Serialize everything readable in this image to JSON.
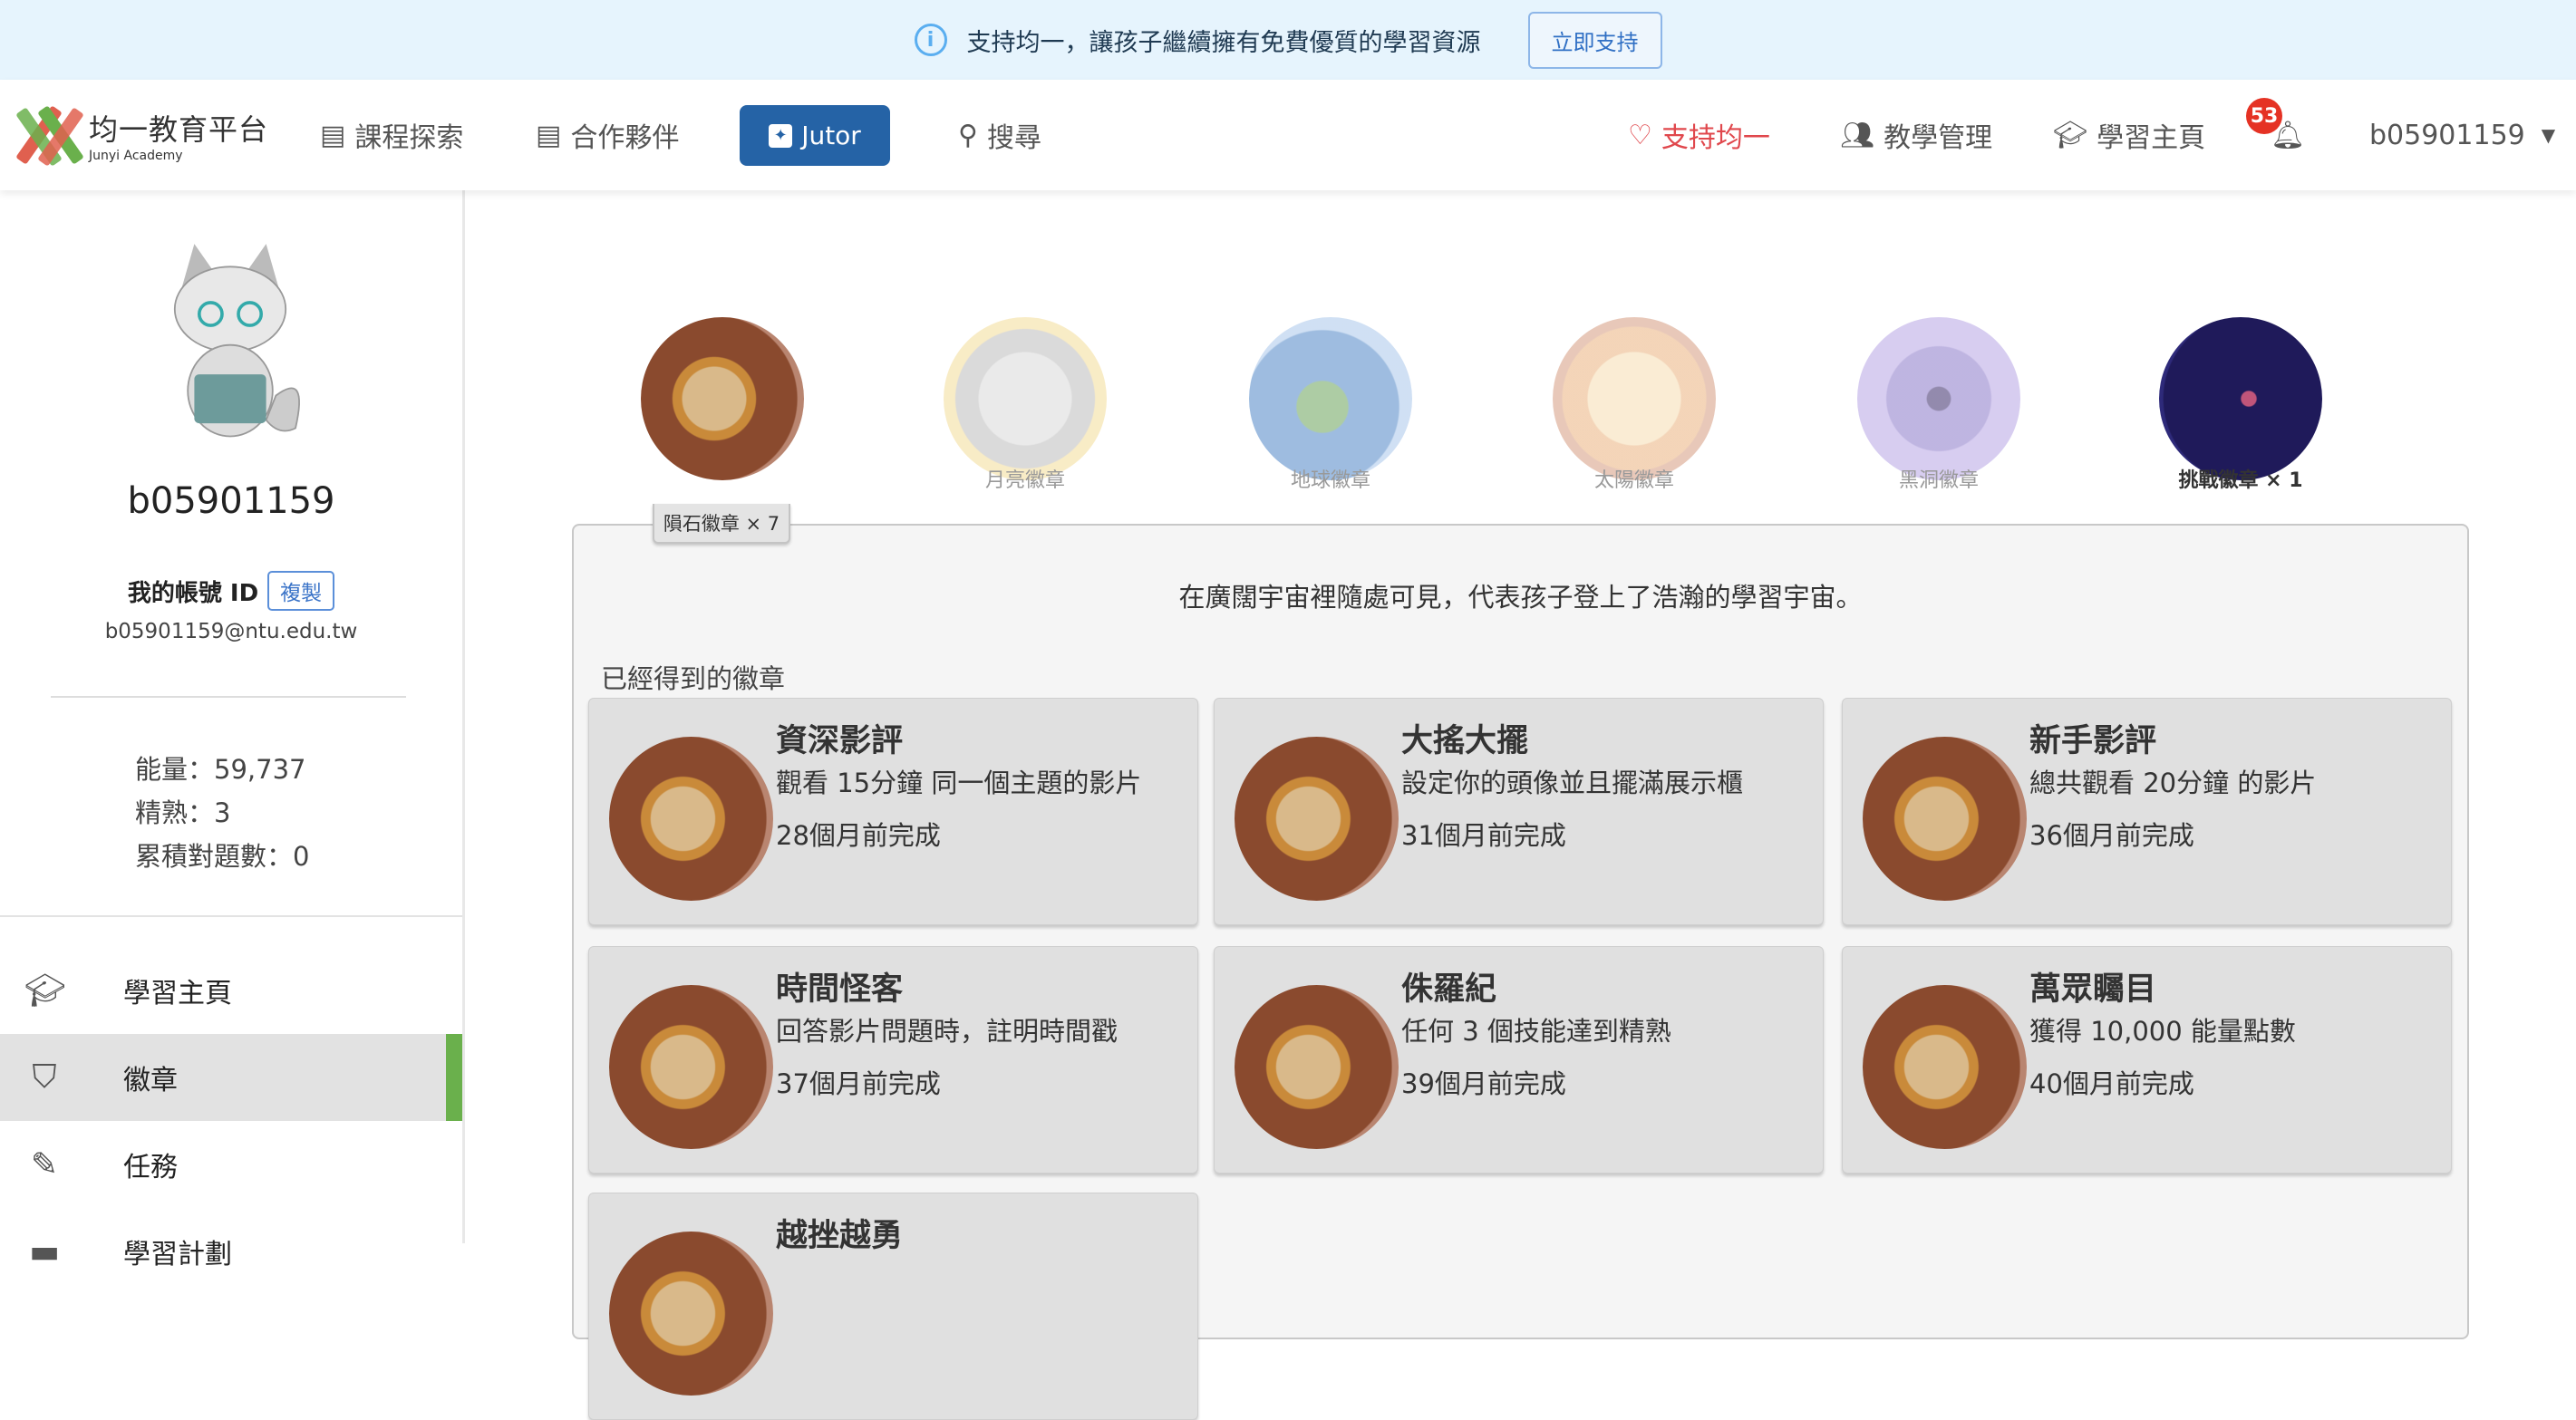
{
  "banner": {
    "text": "支持均一，讓孩子繼續擁有免費優質的學習資源",
    "button": "立即支持",
    "icon": "info-icon"
  },
  "nav": {
    "logo_cn": "均一教育平台",
    "logo_en": "Junyi Academy",
    "items": [
      {
        "label": "課程探索",
        "icon": "book-icon"
      },
      {
        "label": "合作夥伴",
        "icon": "book-icon"
      },
      {
        "label": "Jutor",
        "icon": "sparkle-chat-icon"
      },
      {
        "label": "搜尋",
        "icon": "search-icon"
      }
    ],
    "right": [
      {
        "label": "支持均一",
        "icon": "heart-icon",
        "color": "#e0474c"
      },
      {
        "label": "教學管理",
        "icon": "people-icon"
      },
      {
        "label": "學習主頁",
        "icon": "graduation-cap-icon"
      }
    ],
    "notifications": "53",
    "user": "b05901159"
  },
  "sidebar": {
    "username": "b05901159",
    "id_label": "我的帳號 ID",
    "copy": "複製",
    "email": "b05901159@ntu.edu.tw",
    "stats": [
      "能量：59,737",
      "精熟：3",
      "累積對題數：0"
    ],
    "menu": [
      {
        "label": "學習主頁",
        "icon": "graduation-cap-icon"
      },
      {
        "label": "徽章",
        "icon": "shield-star-icon",
        "active": true
      },
      {
        "label": "任務",
        "icon": "pencil-icon"
      },
      {
        "label": "學習計劃",
        "icon": "folder-icon"
      }
    ],
    "accent": "#6ab04c"
  },
  "badge_types": [
    {
      "label": "隕石徽章 × 7",
      "type": "meteor",
      "active": true
    },
    {
      "label": "月亮徽章",
      "type": "moon"
    },
    {
      "label": "地球徽章",
      "type": "earth"
    },
    {
      "label": "太陽徽章",
      "type": "sun"
    },
    {
      "label": "黑洞徽章",
      "type": "blackhole"
    },
    {
      "label": "挑戰徽章 × 1",
      "type": "challenge"
    }
  ],
  "panel": {
    "tab": "隕石徽章 × 7",
    "description": "在廣闊宇宙裡隨處可見，代表孩子登上了浩瀚的學習宇宙。",
    "earned_heading": "已經得到的徽章",
    "cards": [
      {
        "title": "資深影評",
        "desc": "觀看 15分鐘 同一個主題的影片",
        "time": "28個月前完成"
      },
      {
        "title": "大搖大擺",
        "desc": "設定你的頭像並且擺滿展示櫃",
        "time": "31個月前完成"
      },
      {
        "title": "新手影評",
        "desc": "總共觀看 20分鐘 的影片",
        "time": "36個月前完成"
      },
      {
        "title": "時間怪客",
        "desc": "回答影片問題時，註明時間戳",
        "time": "37個月前完成"
      },
      {
        "title": "侏羅紀",
        "desc": "任何 3 個技能達到精熟",
        "time": "39個月前完成"
      },
      {
        "title": "萬眾矚目",
        "desc": "獲得 10,000 能量點數",
        "time": "40個月前完成"
      },
      {
        "title": "越挫越勇",
        "desc": "",
        "time": ""
      }
    ]
  }
}
